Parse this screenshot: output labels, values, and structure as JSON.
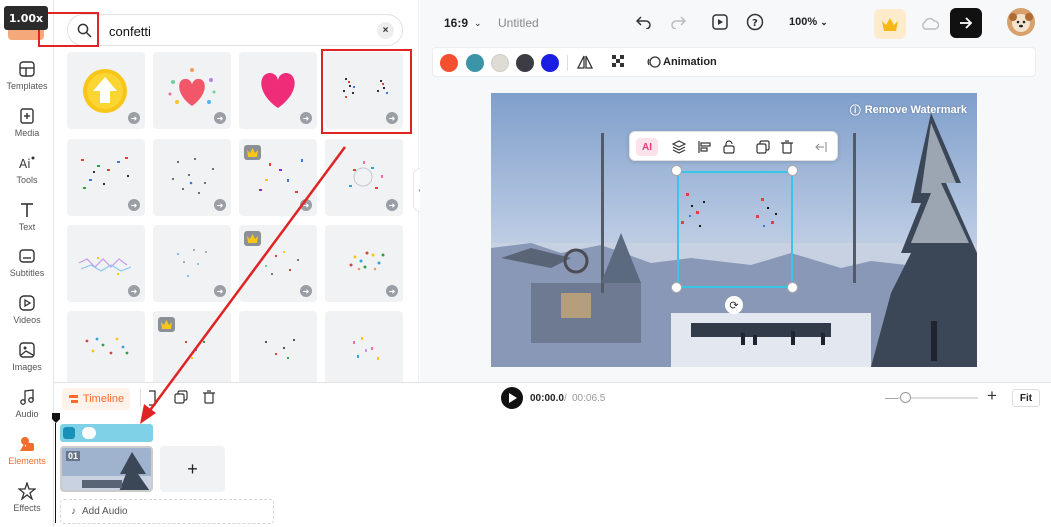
{
  "zoom_badge": "1.00x",
  "rail": {
    "items": [
      {
        "label": "Templates",
        "icon": "templates-icon"
      },
      {
        "label": "Media",
        "icon": "media-icon"
      },
      {
        "label": "Tools",
        "icon": "ai-tools-icon"
      },
      {
        "label": "Text",
        "icon": "text-icon"
      },
      {
        "label": "Subtitles",
        "icon": "subtitles-icon"
      },
      {
        "label": "Videos",
        "icon": "videos-icon"
      },
      {
        "label": "Images",
        "icon": "images-icon"
      },
      {
        "label": "Audio",
        "icon": "audio-icon"
      },
      {
        "label": "Elements",
        "icon": "elements-icon"
      },
      {
        "label": "Effects",
        "icon": "effects-icon"
      }
    ],
    "active": "Elements"
  },
  "search": {
    "value": "confetti",
    "clear_icon": "close-icon"
  },
  "topbar": {
    "aspect_ratio": "16:9",
    "title": "Untitled",
    "zoom": "100%"
  },
  "toolbar": {
    "colors": [
      "#f4502f",
      "#3b94a7",
      "#dedcd3",
      "#3c3c44",
      "#1a1ee0"
    ],
    "animation_label": "Animation"
  },
  "canvas": {
    "watermark_label": "Remove Watermark"
  },
  "timeline": {
    "tab_label": "Timeline",
    "current_time": "00:00.0",
    "separator": "/",
    "total_time": "00:06.5",
    "fit_label": "Fit",
    "clip_label": "01",
    "add_label": "+",
    "add_audio_label": "Add Audio"
  },
  "accent_color": "#f36d2b",
  "annotation_color": "#e02424"
}
